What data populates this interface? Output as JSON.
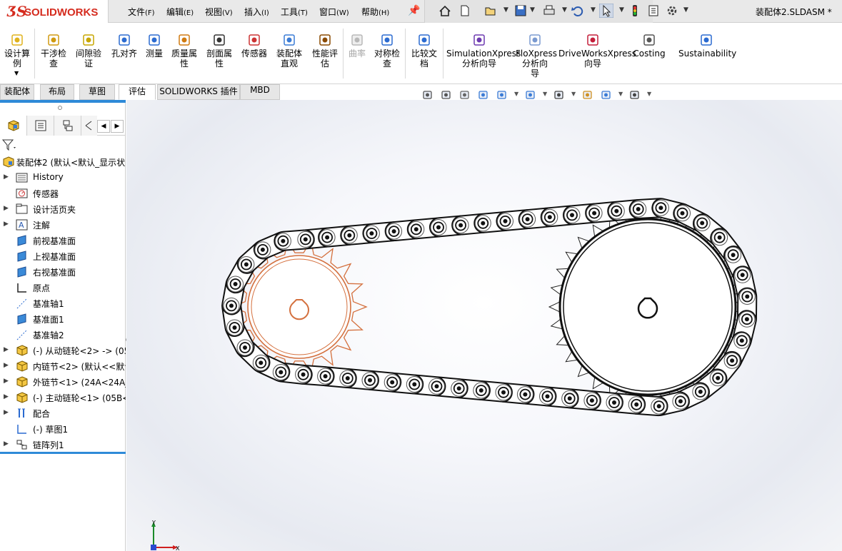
{
  "app": {
    "logo": "SOLIDWORKS",
    "document_title": "装配体2.SLDASM *"
  },
  "menu": [
    {
      "label": "文件",
      "key": "(F)"
    },
    {
      "label": "编辑",
      "key": "(E)"
    },
    {
      "label": "视图",
      "key": "(V)"
    },
    {
      "label": "插入",
      "key": "(I)"
    },
    {
      "label": "工具",
      "key": "(T)"
    },
    {
      "label": "窗口",
      "key": "(W)"
    },
    {
      "label": "帮助",
      "key": "(H)"
    }
  ],
  "quick_access": [
    "home-icon",
    "new-document-icon",
    "open-icon",
    "save-icon",
    "print-icon",
    "undo-icon",
    "select-icon",
    "rebuild-icon",
    "file-properties-icon",
    "options-icon"
  ],
  "ribbon": {
    "buttons": [
      {
        "id": "design-calculator",
        "line1": "设计算",
        "line2": "例",
        "icon": "design-study-icon",
        "enabled": true
      },
      {
        "id": "interference",
        "line1": "干涉检",
        "line2": "查",
        "icon": "interference-detection-icon",
        "enabled": true
      },
      {
        "id": "clearance",
        "line1": "间隙验",
        "line2": "证",
        "icon": "clearance-verification-icon",
        "enabled": true
      },
      {
        "id": "hole-align",
        "line1": "孔对齐",
        "line2": "",
        "icon": "hole-alignment-icon",
        "enabled": true
      },
      {
        "id": "measure",
        "line1": "测量",
        "line2": "",
        "icon": "measure-icon",
        "enabled": true
      },
      {
        "id": "mass-props",
        "line1": "质量属",
        "line2": "性",
        "icon": "mass-properties-icon",
        "enabled": true
      },
      {
        "id": "section-props",
        "line1": "剖面属",
        "line2": "性",
        "icon": "section-properties-icon",
        "enabled": true
      },
      {
        "id": "sensor",
        "line1": "传感器",
        "line2": "",
        "icon": "sensor-icon",
        "enabled": true
      },
      {
        "id": "assembly-visual",
        "line1": "装配体",
        "line2": "直观",
        "icon": "assembly-visualization-icon",
        "enabled": true
      },
      {
        "id": "performance",
        "line1": "性能评",
        "line2": "估",
        "icon": "performance-evaluation-icon",
        "enabled": true
      },
      {
        "id": "curvature",
        "line1": "曲率",
        "line2": "",
        "icon": "curvature-icon",
        "enabled": false
      },
      {
        "id": "symmetry",
        "line1": "对称检",
        "line2": "查",
        "icon": "symmetry-check-icon",
        "enabled": true
      },
      {
        "id": "compare",
        "line1": "比较文",
        "line2": "档",
        "icon": "compare-documents-icon",
        "enabled": true
      },
      {
        "id": "simxpress",
        "line1": "SimulationXpress",
        "line2": "分析向导",
        "line3": "",
        "icon": "simulationxpress-icon",
        "enabled": true
      },
      {
        "id": "floxpress",
        "line1": "FloXpress",
        "line2": "分析向",
        "line3": "导",
        "icon": "floxpress-icon",
        "enabled": true
      },
      {
        "id": "driveworks",
        "line1": "DriveWorksXpress",
        "line2": "向导",
        "line3": "",
        "icon": "driveworksxpress-icon",
        "enabled": true
      },
      {
        "id": "costing",
        "line1": "Costing",
        "line2": "",
        "line3": "",
        "icon": "costing-icon",
        "enabled": true
      },
      {
        "id": "sustainability",
        "line1": "Sustainability",
        "line2": "",
        "line3": "",
        "icon": "sustainability-icon",
        "enabled": true
      }
    ]
  },
  "command_tabs": [
    {
      "label": "装配体",
      "active": false
    },
    {
      "label": "布局",
      "active": false
    },
    {
      "label": "草图",
      "active": false
    },
    {
      "label": "评估",
      "active": true
    },
    {
      "label": "SOLIDWORKS 插件",
      "active": false
    },
    {
      "label": "MBD",
      "active": false
    }
  ],
  "feature_tree": {
    "root": "装配体2  (默认<默认_显示状",
    "items": [
      {
        "label": "History",
        "icon": "history-folder-icon",
        "expand": true
      },
      {
        "label": "传感器",
        "icon": "sensor-folder-icon",
        "expand": false
      },
      {
        "label": "设计活页夹",
        "icon": "design-binder-icon",
        "expand": true
      },
      {
        "label": "注解",
        "icon": "annotations-icon",
        "expand": true
      },
      {
        "label": "前视基准面",
        "icon": "plane-icon",
        "expand": false
      },
      {
        "label": "上视基准面",
        "icon": "plane-icon",
        "expand": false
      },
      {
        "label": "右视基准面",
        "icon": "plane-icon",
        "expand": false
      },
      {
        "label": "原点",
        "icon": "origin-icon",
        "expand": false
      },
      {
        "label": "基准轴1",
        "icon": "axis-icon",
        "expand": false
      },
      {
        "label": "基准面1",
        "icon": "plane-icon",
        "expand": false
      },
      {
        "label": "基准轴2",
        "icon": "axis-icon",
        "expand": false
      },
      {
        "label": "(-) 从动链轮<2> -> (05",
        "icon": "part-icon",
        "expand": true
      },
      {
        "label": "内链节<2> (默认<<默认",
        "icon": "part-icon",
        "expand": true
      },
      {
        "label": "外链节<1> (24A<24A_",
        "icon": "part-icon",
        "expand": true
      },
      {
        "label": "(-) 主动链轮<1> (05B<",
        "icon": "part-icon",
        "expand": true
      },
      {
        "label": "配合",
        "icon": "mates-icon",
        "expand": true
      },
      {
        "label": "(-) 草图1",
        "icon": "sketch-icon",
        "expand": false
      },
      {
        "label": "链阵列1",
        "icon": "chain-pattern-icon",
        "expand": true
      }
    ]
  },
  "heads_up_toolbar": [
    "zoom-to-fit-icon",
    "zoom-to-area-icon",
    "previous-view-icon",
    "section-view-icon",
    "view-orientation-icon",
    "display-style-icon",
    "hide-show-icon",
    "edit-appearance-icon",
    "apply-scene-icon",
    "view-settings-icon"
  ],
  "triad": {
    "x_label": "X",
    "y_label": "Y"
  },
  "colors": {
    "accent": "#2e8ad8",
    "brand_red": "#d52b1e",
    "selected_sprocket": "#d4703e",
    "chain": "#1a1a1a"
  }
}
